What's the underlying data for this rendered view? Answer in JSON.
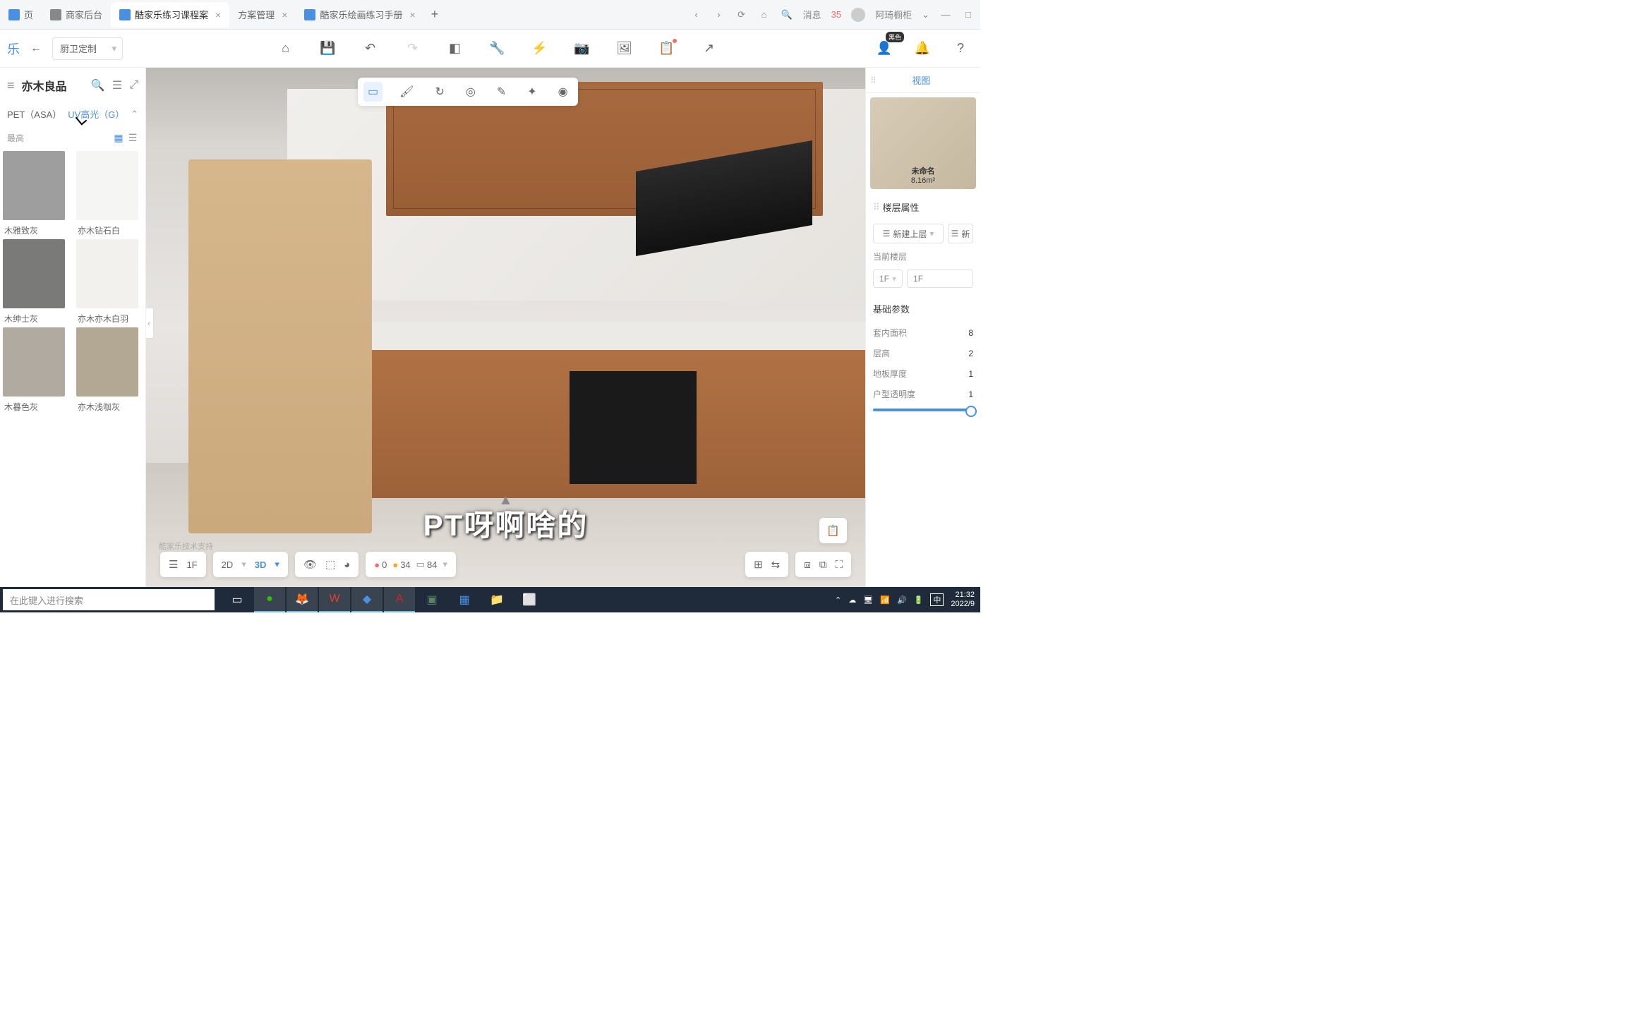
{
  "browser": {
    "tabs": [
      {
        "label": "页",
        "icon": "blue"
      },
      {
        "label": "商家后台",
        "icon": "gray"
      },
      {
        "label": "酷家乐练习课程案",
        "icon": "blue",
        "active": true
      },
      {
        "label": "方案管理",
        "icon": "none"
      },
      {
        "label": "酷家乐绘画练习手册",
        "icon": "blue"
      }
    ],
    "msg_label": "消息",
    "msg_count": "35",
    "username": "阿琦橱柜"
  },
  "toolbar": {
    "mode_select": "厨卫定制",
    "user_tag": "黑色"
  },
  "left_panel": {
    "title": "亦木良品",
    "tabs": {
      "a": "PET（ASA）",
      "b": "UV高光（G）"
    },
    "sort_label": "最高",
    "swatches": [
      {
        "name": "木雅致灰",
        "color": "#9e9e9e"
      },
      {
        "name": "亦木钻石白",
        "color": "#f5f5f3"
      },
      {
        "name": "木绅士灰",
        "color": "#7a7a78"
      },
      {
        "name": "亦木亦木白羽",
        "color": "#f2f1ee"
      },
      {
        "name": "木暮色灰",
        "color": "#b0aaa0"
      },
      {
        "name": "亦木浅咖灰",
        "color": "#b3a893"
      }
    ]
  },
  "viewport": {
    "subtitle": "PT呀啊啥的",
    "watermark": "酷家乐技术支持",
    "status": {
      "red": "0",
      "orange": "34",
      "gray": "84"
    },
    "floor_label": "1F",
    "view_2d": "2D",
    "view_3d": "3D"
  },
  "right_panel": {
    "tab": "视图",
    "thumb": {
      "name": "未命名",
      "area": "8.16m²"
    },
    "section_floor": "楼层属性",
    "btn_new_upper": "新建上层",
    "btn_new": "新",
    "current_floor_label": "当前楼层",
    "floor_short": "1F",
    "floor_name": "1F",
    "section_params": "基础参数",
    "fields": {
      "area": {
        "label": "套内面积",
        "val": "8"
      },
      "height": {
        "label": "层高",
        "val": "2"
      },
      "floor_thick": {
        "label": "地板厚度",
        "val": "1"
      },
      "opacity": {
        "label": "户型透明度",
        "val": "1"
      }
    }
  },
  "taskbar": {
    "search_placeholder": "在此键入进行搜索",
    "clock": "21:32",
    "date": "2022/9",
    "ime": "中"
  }
}
